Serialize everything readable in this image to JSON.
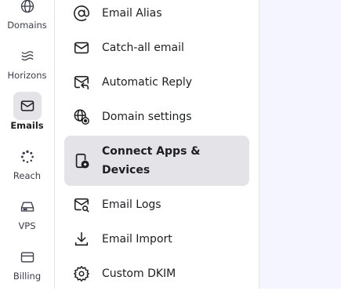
{
  "rail": {
    "items": [
      {
        "label": "Domains",
        "icon": "globe-icon"
      },
      {
        "label": "Horizons",
        "icon": "waves-icon"
      },
      {
        "label": "Emails",
        "icon": "envelope-icon"
      },
      {
        "label": "Reach",
        "icon": "loader-icon"
      },
      {
        "label": "VPS",
        "icon": "server-icon"
      },
      {
        "label": "Billing",
        "icon": "credit-card-icon"
      }
    ],
    "active_index": 2
  },
  "menu": {
    "items": [
      {
        "label": "Email Alias",
        "icon": "at-icon"
      },
      {
        "label": "Catch-all email",
        "icon": "envelope-icon"
      },
      {
        "label": "Automatic Reply",
        "icon": "auto-reply-icon"
      },
      {
        "label": "Domain settings",
        "icon": "globe-settings-icon"
      },
      {
        "label": "Connect Apps & Devices",
        "icon": "device-connect-icon"
      },
      {
        "label": "Email Logs",
        "icon": "mail-search-icon"
      },
      {
        "label": "Email Import",
        "icon": "download-icon"
      },
      {
        "label": "Custom DKIM",
        "icon": "gear-icon"
      }
    ],
    "active_index": 4
  },
  "colors": {
    "active_bg": "#e3e3e8",
    "content_bg": "#f4f5ff",
    "text": "#1d1e20"
  }
}
